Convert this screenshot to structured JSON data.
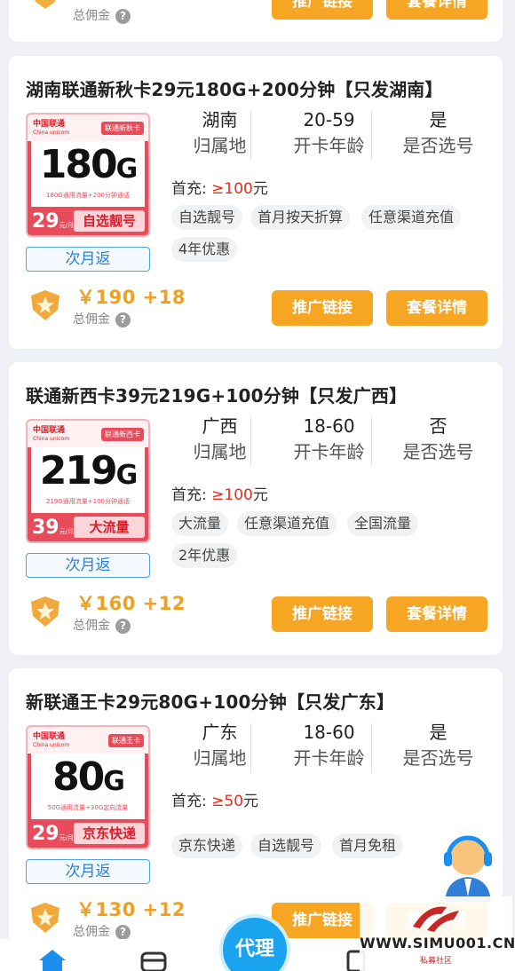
{
  "top_card": {
    "commission_label": "总佣金",
    "btn_promote": "推广链接",
    "btn_detail": "套餐详情",
    "question": "?"
  },
  "cards": [
    {
      "title": "湖南联通新秋卡29元180G+200分钟【只发湖南】",
      "sim": {
        "brand": "中国联通",
        "brand_en": "China unicom",
        "name": "联通新秋卡",
        "data": "180",
        "data_unit": "G",
        "desc": "180G通用流量+200分钟通话",
        "price": "29",
        "price_unit": "元/月",
        "tag": "自选靓号"
      },
      "rebate": "次月返",
      "attrs": [
        {
          "value": "湖南",
          "label": "归属地"
        },
        {
          "value": "20-59",
          "label": "开卡年龄"
        },
        {
          "value": "是",
          "label": "是否选号"
        }
      ],
      "recharge_label": "首充:",
      "recharge_amount": "≥100",
      "recharge_unit": "元",
      "tags": [
        "自选靓号",
        "首月按天折算",
        "任意渠道充值",
        "4年优惠"
      ],
      "commission": "￥190 +18",
      "commission_label": "总佣金",
      "question": "?",
      "btn_promote": "推广链接",
      "btn_detail": "套餐详情"
    },
    {
      "title": "联通新西卡39元219G+100分钟【只发广西】",
      "sim": {
        "brand": "中国联通",
        "brand_en": "China unicom",
        "name": "联通新西卡",
        "data": "219",
        "data_unit": "G",
        "desc": "219G通用流量+100分钟通话",
        "price": "39",
        "price_unit": "元/月",
        "tag": "大流量"
      },
      "rebate": "次月返",
      "attrs": [
        {
          "value": "广西",
          "label": "归属地"
        },
        {
          "value": "18-60",
          "label": "开卡年龄"
        },
        {
          "value": "否",
          "label": "是否选号"
        }
      ],
      "recharge_label": "首充:",
      "recharge_amount": "≥100",
      "recharge_unit": "元",
      "tags": [
        "大流量",
        "任意渠道充值",
        "全国流量",
        "2年优惠"
      ],
      "commission": "￥160 +12",
      "commission_label": "总佣金",
      "question": "?",
      "btn_promote": "推广链接",
      "btn_detail": "套餐详情"
    },
    {
      "title": "新联通王卡29元80G+100分钟【只发广东】",
      "sim": {
        "brand": "中国联通",
        "brand_en": "China unicom",
        "name": "联通王卡",
        "data": "80",
        "data_unit": "G",
        "desc": "50G通用流量+30G定向流量",
        "price": "29",
        "price_unit": "元/月",
        "tag": "京东快递"
      },
      "rebate": "次月返",
      "attrs": [
        {
          "value": "广东",
          "label": "归属地"
        },
        {
          "value": "18-60",
          "label": "开卡年龄"
        },
        {
          "value": "是",
          "label": "是否选号"
        }
      ],
      "recharge_label": "首充:",
      "recharge_amount": "≥50",
      "recharge_unit": "元",
      "tags": [
        "京东快递",
        "自选靓号",
        "首月免租"
      ],
      "commission": "￥130 +12",
      "commission_label": "总佣金",
      "question": "?",
      "btn_promote": "推广链接",
      "btn_detail": "套餐详情"
    }
  ],
  "agent_button": "代理",
  "watermark": {
    "text": "WWW.SIMU001.CN",
    "sub": "私募社区"
  },
  "colors": {
    "accent": "#f6a623",
    "unicom_red": "#e84c5a",
    "agent_blue": "#1aa4f0"
  }
}
